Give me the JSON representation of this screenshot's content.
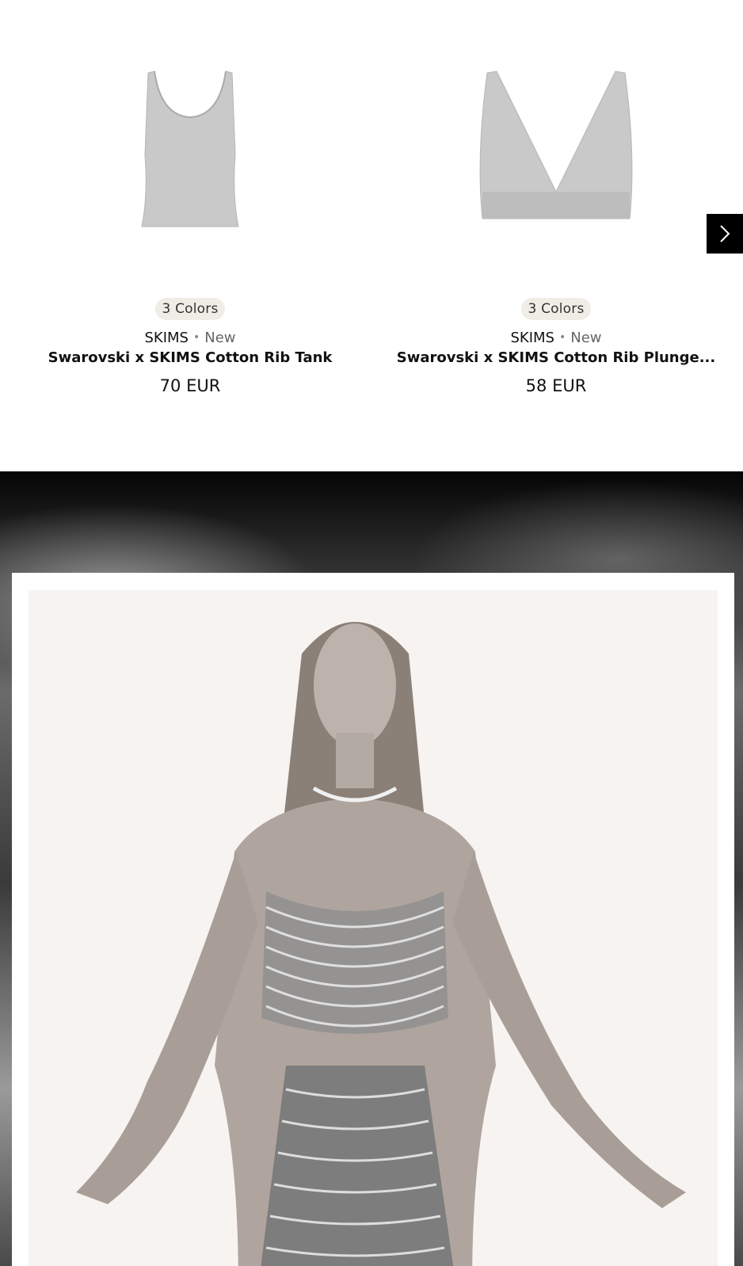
{
  "products": [
    {
      "colors_badge": "3 Colors",
      "brand": "SKIMS",
      "tag": "New",
      "name": "Swarovski x SKIMS Cotton Rib Tank",
      "price": "70 EUR",
      "image_icon": "tank-top-image"
    },
    {
      "colors_badge": "3 Colors",
      "brand": "SKIMS",
      "tag": "New",
      "name": "Swarovski x SKIMS Cotton Rib Plunge...",
      "price": "58 EUR",
      "image_icon": "plunge-bralette-image"
    }
  ],
  "carousel": {
    "next_icon": "chevron-right-icon"
  },
  "hero": {
    "image": "campaign-photo-model-in-crystal-outfit"
  },
  "colors": {
    "badge_bg": "#efede6",
    "next_button_bg": "#000000",
    "hero_frame": "#ffffff",
    "photo_bg": "#f7f3f1"
  }
}
